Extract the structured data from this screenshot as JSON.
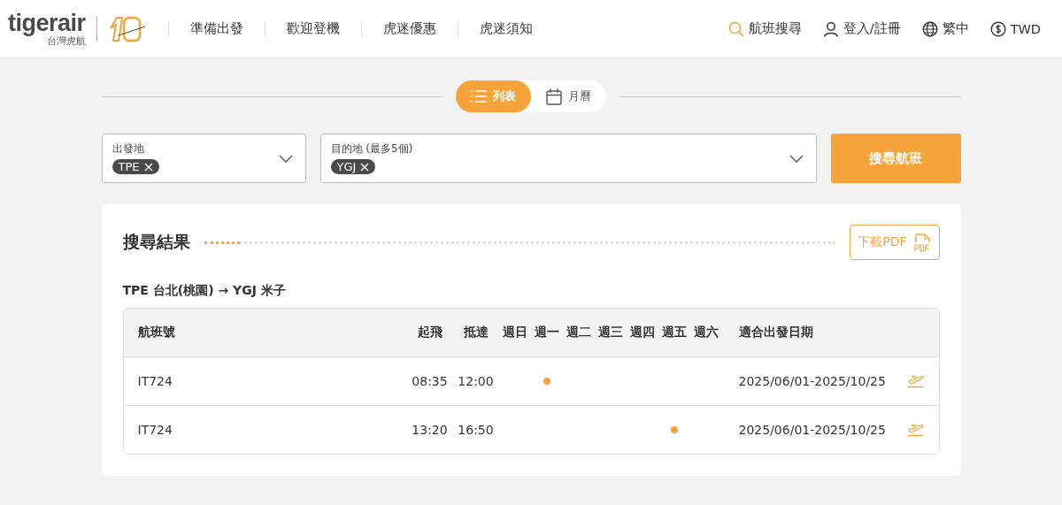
{
  "header": {
    "logo": {
      "brand": "tigerair",
      "subtitle": "台灣虎航"
    },
    "nav": [
      "準備出發",
      "歡迎登機",
      "虎迷優惠",
      "虎迷須知"
    ],
    "utilities": [
      {
        "kind": "search",
        "label": "航班搜尋"
      },
      {
        "kind": "user",
        "label": "登入/註冊"
      },
      {
        "kind": "globe",
        "label": "繁中"
      },
      {
        "kind": "currency",
        "label": "TWD"
      }
    ]
  },
  "view_toggle": [
    {
      "kind": "list",
      "label": "列表",
      "selected": true
    },
    {
      "kind": "calendar",
      "label": "月曆",
      "selected": false
    }
  ],
  "search": {
    "origin": {
      "label": "出發地",
      "tags": [
        "TPE"
      ]
    },
    "destination": {
      "label": "目的地 (最多5個)",
      "tags": [
        "YGJ"
      ]
    },
    "button": "搜尋航班"
  },
  "results": {
    "title": "搜尋結果",
    "pdf_button": "下載PDF",
    "route": "TPE 台北(桃園) → YGJ 米子",
    "columns": [
      "航班號",
      "起飛",
      "抵達",
      "週日",
      "週一",
      "週二",
      "週三",
      "週四",
      "週五",
      "週六",
      "適合出發日期"
    ],
    "rows": [
      {
        "flight": "IT724",
        "departure": "08:35",
        "arrival": "12:00",
        "days": [
          {
            "kind": "none"
          },
          {
            "kind": "dot"
          },
          {
            "kind": "none"
          },
          {
            "kind": "none"
          },
          {
            "kind": "none"
          },
          {
            "kind": "none"
          },
          {
            "kind": "none"
          }
        ],
        "period": "2025/06/01-2025/10/25"
      },
      {
        "flight": "IT724",
        "departure": "13:20",
        "arrival": "16:50",
        "days": [
          {
            "kind": "none"
          },
          {
            "kind": "none"
          },
          {
            "kind": "none"
          },
          {
            "kind": "none"
          },
          {
            "kind": "none"
          },
          {
            "kind": "dot"
          },
          {
            "kind": "none"
          }
        ],
        "period": "2025/06/01-2025/10/25"
      }
    ]
  }
}
